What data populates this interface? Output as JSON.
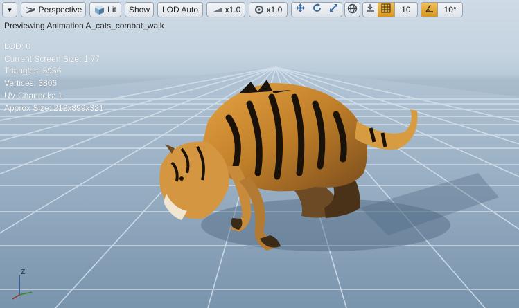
{
  "toolbar": {
    "menu_arrow": "▾",
    "perspective_label": "Perspective",
    "lit_label": "Lit",
    "show_label": "Show",
    "lod_label": "LOD Auto",
    "playback_speed": "x1.0",
    "rotation_speed": "x1.0",
    "grid_snap_value": "10",
    "angle_snap_value": "10°",
    "accent_color": "#e0a332"
  },
  "viewport": {
    "preview_title": "Previewing Animation A_cats_combat_walk",
    "stats": {
      "lod": "LOD: 0",
      "screen_size": "Current Screen Size: 1.77",
      "triangles": "Triangles: 5956",
      "vertices": "Vertices: 3806",
      "uv_channels": "UV Channels: 1",
      "approx_size": "Approx Size: 212x899x321"
    },
    "axis_label": "Z"
  }
}
